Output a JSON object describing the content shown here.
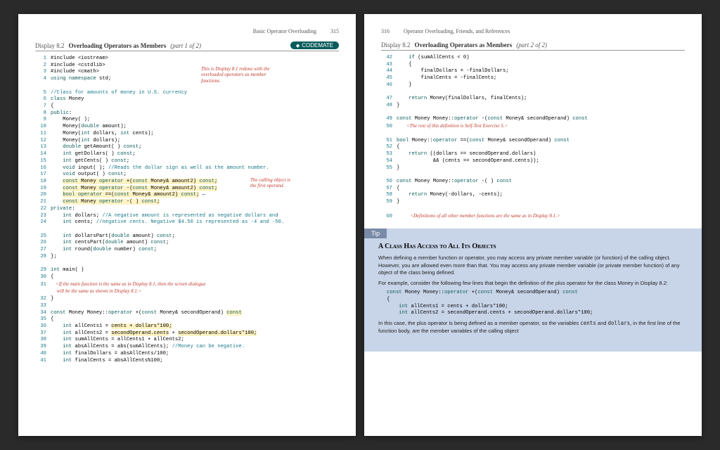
{
  "left": {
    "header_section": "Basic Operator Overloading",
    "header_page": "315",
    "display_num": "Display 8.2",
    "display_title": "Overloading Operators as Members",
    "display_part": "(part 1 of 2)",
    "badge": "CODEMATE",
    "annot1_l1": "This is Display 8.1 redone with the",
    "annot1_l2": "overloaded operators as member",
    "annot1_l3": "functions.",
    "annot2_l1": "The calling object is",
    "annot2_l2": "the first operand.",
    "lines": {
      "1": "#include <iostream>",
      "2": "#include <cstdlib>",
      "3": "#include <cmath>",
      "4a": "using namespace",
      "4b": " std;",
      "5": "//Class for amounts of money in U.S. currency",
      "6a": "class",
      "6b": " Money",
      "7": "{",
      "8": "public",
      "9": "    Money( );",
      "10a": "    Money(",
      "10b": "double",
      "10c": " amount);",
      "11a": "    Money(",
      "11b": "int",
      "11c": " dollars, ",
      "11d": "int",
      "11e": " cents);",
      "12a": "    Money(",
      "12b": "int",
      "12c": " dollars);",
      "13a": "    ",
      "13b": "double",
      "13c": " getAmount( ) ",
      "13d": "const",
      "14a": "    ",
      "14b": "int",
      "14c": " getDollars( ) ",
      "14d": "const",
      "15a": "    ",
      "15b": "int",
      "15c": " getCents( ) ",
      "15d": "const",
      "16a": "    ",
      "16b": "void",
      "16c": " input( ); ",
      "16d": "//Reads the dollar sign as well as the amount number.",
      "17a": "    ",
      "17b": "void",
      "17c": " output( ) ",
      "17d": "const",
      "18a": "    ",
      "18b": "const",
      "18c": " Money ",
      "18d": "operator",
      "18e": " +(",
      "18f": "const",
      "18g": " Money& amount2) ",
      "18h": "const",
      "19a": "    ",
      "19b": "const",
      "19c": " Money ",
      "19d": "operator",
      "19e": " -(",
      "19f": "const",
      "19g": " Money& amount2) ",
      "19h": "const",
      "20a": "    ",
      "20b": "bool operator",
      "20c": " ==(",
      "20d": "const",
      "20e": " Money& amount2) ",
      "20f": "const",
      "21a": "    ",
      "21b": "const",
      "21c": " Money ",
      "21d": "operator",
      "21e": " -( ) ",
      "21f": "const",
      "22": "private",
      "23a": "    ",
      "23b": "int",
      "23c": " dollars; ",
      "23d": "//A negative amount is represented as negative dollars and",
      "24a": "    ",
      "24b": "int",
      "24c": " cents; ",
      "24d": "//negative cents. Negative $4.50 is represented as -4 and -50.",
      "25a": "    ",
      "25b": "int",
      "25c": " dollarsPart(",
      "25d": "double",
      "25e": " amount) ",
      "25f": "const",
      "26a": "    ",
      "26b": "int",
      "26c": " centsPart(",
      "26d": "double",
      "26e": " amount) ",
      "26f": "const",
      "27a": "    ",
      "27b": "int",
      "27c": " round(",
      "27d": "double",
      "27e": " number) ",
      "27f": "const",
      "28": "};",
      "29a": "int",
      "29b": " main( )",
      "30": "{",
      "31a": "    <If the ",
      "31b": "main",
      "31c": " function is the same as in Display 8.1, then the screen dialogue",
      "31d": "     will be the same as shown in Display 8.1.>",
      "32": "}",
      "34a": "const",
      "34b": " Money Money::",
      "34c": "operator",
      "34d": " +(",
      "34e": "const",
      "34f": " Money& secondOperand) ",
      "34g": "const",
      "35": "{",
      "36a": "    ",
      "36b": "int",
      "36c": " allCents1 = ",
      "36d": "cents + dollars*100;",
      "37a": "    ",
      "37b": "int",
      "37c": " allCents2 = ",
      "37d": "secondOperand.cents",
      "37e": " + ",
      "37f": "secondOperand.dollars*100;",
      "38a": "    ",
      "38b": "int",
      "38c": " sumAllCents = allCents1 + allCents2;",
      "39a": "    ",
      "39b": "int",
      "39c": " absAllCents = abs(sumAllCents); ",
      "39d": "//Money can be negative.",
      "40a": "    ",
      "40b": "int",
      "40c": " finalDollars = absAllCents/100;",
      "41a": "    ",
      "41b": "int",
      "41c": " finalCents = absAllCents%100;"
    }
  },
  "right": {
    "header_page": "316",
    "header_section": "Operator Overloading, Friends, and References",
    "display_num": "Display 8.2",
    "display_title": "Overloading Operators as Members",
    "display_part": "(part 2 of 2)",
    "lines": {
      "42a": "    ",
      "42b": "if",
      "42c": " (sumAllCents < 0)",
      "43": "    {",
      "44": "        finalDollars = -finalDollars;",
      "45": "        finalCents = -finalCents;",
      "46": "    }",
      "47a": "    ",
      "47b": "return",
      "47c": " Money(finalDollars, finalCents);",
      "48": "}",
      "49a": "const",
      "49b": " Money Money::",
      "49c": "operator",
      "49d": " -(",
      "49e": "const",
      "49f": " Money& secondOperand) ",
      "49g": "const",
      "50": "        <The rest of this definition is Self-Test Exercise 5.>",
      "51a": "bool",
      "51b": " Money::",
      "51c": "operator",
      "51d": " ==(",
      "51e": "const",
      "51f": " Money& secondOperand) ",
      "51g": "const",
      "52": "{",
      "53a": "    ",
      "53b": "return",
      "53c": " ((dollars == secondOperand.dollars)",
      "54": "            && (cents == secondOperand.cents));",
      "55": "}",
      "56a": "const",
      "56b": " Money Money::",
      "56c": "operator",
      "56d": " -( ) ",
      "56e": "const",
      "57": "{",
      "58a": "    ",
      "58b": "return",
      "58c": " Money(-dollars, -cents);",
      "59": "}",
      "60": "           <Definitions of all other member functions are the same as in Display 8.1.>"
    },
    "tip": {
      "tab": "Tip",
      "title": "A Class Has Access to All Its Objects",
      "p1": "When defining a member function or operator, you may access any private member variable (or function) of the calling object. However, you are allowed even more than that. You may access any private member variable (or private member function) of any object of the class being defined.",
      "p2": "For example, consider the following few lines that begin the definition of the plus operator for the class Money in Display 8.2:",
      "c1a": "const",
      "c1b": " Money Money::",
      "c1c": "operator",
      "c1d": " +(",
      "c1e": "const",
      "c1f": " Money& secondOperand) ",
      "c1g": "const",
      "c2": "{",
      "c3a": "    ",
      "c3b": "int",
      "c3c": " allCents1 = cents + dollars*100;",
      "c4a": "    ",
      "c4b": "int",
      "c4c": " allCents2 = secondOperand.cents + secondOperand.dollars*100;",
      "p3a": "In this case, the plus operator is being defined as a member operator, so the variables ",
      "p3b": "cents",
      "p3c": " and ",
      "p3d": "dollars",
      "p3e": ", in the first line of the function body, are the member variables of the calling object"
    }
  }
}
